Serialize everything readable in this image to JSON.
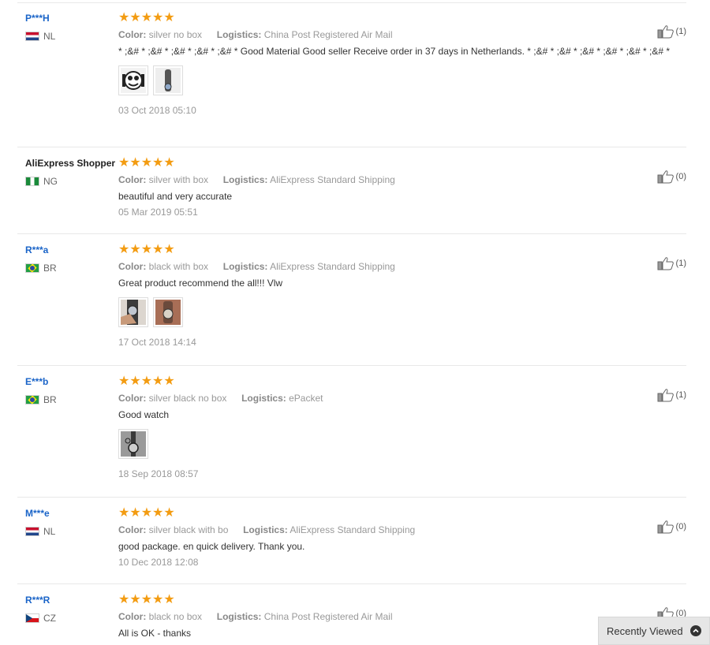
{
  "reviews": [
    {
      "buyer": "P***H",
      "buyer_style": "link",
      "country": "NL",
      "flag": "nl",
      "stars": "★★★★★",
      "color_label": "Color:",
      "color_value": "silver no box",
      "logistics_label": "Logistics:",
      "logistics_value": "China Post Registered Air Mail",
      "text": "* ;&# * ;&# * ;&# * ;&# * ;&# * Good Material Good seller Receive order in 37 days in Netherlands. * ;&# * ;&# * ;&# * ;&# * ;&# * ;&# *",
      "photos": [
        "cartoon-watch-photo",
        "watch-strap-photo"
      ],
      "date": "03 Oct 2018 05:10",
      "helpful": "(1)"
    },
    {
      "buyer": "AliExpress Shopper",
      "buyer_style": "plain",
      "country": "NG",
      "flag": "ng",
      "stars": "★★★★★",
      "color_label": "Color:",
      "color_value": "silver with box",
      "logistics_label": "Logistics:",
      "logistics_value": "AliExpress Standard Shipping",
      "text": "beautiful and very accurate",
      "photos": [],
      "date": "05 Mar 2019 05:51",
      "helpful": "(0)"
    },
    {
      "buyer": "R***a",
      "buyer_style": "link",
      "country": "BR",
      "flag": "br",
      "stars": "★★★★★",
      "color_label": "Color:",
      "color_value": "black with box",
      "logistics_label": "Logistics:",
      "logistics_value": "AliExpress Standard Shipping",
      "text": "Great product recommend the all!!! Vlw",
      "photos": [
        "wrist-watch-photo",
        "watch-closeup-photo"
      ],
      "date": "17 Oct 2018 14:14",
      "helpful": "(1)"
    },
    {
      "buyer": "E***b",
      "buyer_style": "link",
      "country": "BR",
      "flag": "br",
      "stars": "★★★★★",
      "color_label": "Color:",
      "color_value": "silver black no box",
      "logistics_label": "Logistics:",
      "logistics_value": "ePacket",
      "text": "Good watch",
      "photos": [
        "watch-on-table-photo"
      ],
      "date": "18 Sep 2018 08:57",
      "helpful": "(1)"
    },
    {
      "buyer": "M***e",
      "buyer_style": "link",
      "country": "NL",
      "flag": "nl",
      "stars": "★★★★★",
      "color_label": "Color:",
      "color_value": "silver black with bo",
      "logistics_label": "Logistics:",
      "logistics_value": "AliExpress Standard Shipping",
      "text": "good package. en quick delivery. Thank you.",
      "photos": [],
      "date": "10 Dec 2018 12:08",
      "helpful": "(0)"
    },
    {
      "buyer": "R***R",
      "buyer_style": "link",
      "country": "CZ",
      "flag": "cz",
      "stars": "★★★★★",
      "color_label": "Color:",
      "color_value": "black no box",
      "logistics_label": "Logistics:",
      "logistics_value": "China Post Registered Air Mail",
      "text": "All is OK - thanks",
      "photos": [],
      "date": "",
      "helpful": "(0)"
    }
  ],
  "recently_viewed": {
    "label": "Recently Viewed",
    "icon": "chevron-up-icon"
  },
  "colors": {
    "buyer_link": "#1a64c8",
    "stars": "#f39c12",
    "muted": "#999999"
  }
}
